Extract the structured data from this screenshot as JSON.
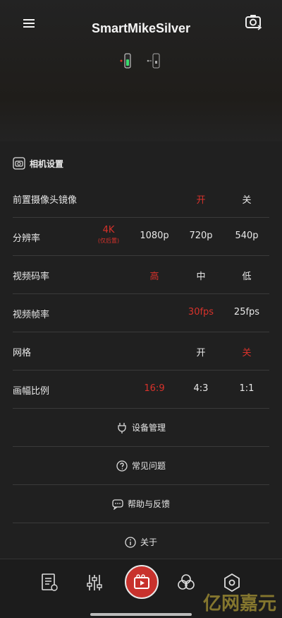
{
  "header": {
    "title": "SmartMikeSilver",
    "icons": [
      "menu-icon",
      "camera-switch-icon",
      "mic-device-icon",
      "phone-device-icon"
    ]
  },
  "section": {
    "label": "相机设置",
    "icon": "camera-settings-icon"
  },
  "settings": {
    "front_mirror": {
      "label": "前置摄像头镜像",
      "on": "开",
      "off": "关",
      "selected": "开"
    },
    "resolution": {
      "label": "分辨率",
      "opt_4k": "4K",
      "opt_4k_note": "(仅后置)",
      "opt_1080": "1080p",
      "opt_720": "720p",
      "opt_540": "540p",
      "selected": "4K"
    },
    "bitrate": {
      "label": "视频码率",
      "high": "高",
      "mid": "中",
      "low": "低",
      "selected": "高"
    },
    "framerate": {
      "label": "视频帧率",
      "fps30": "30fps",
      "fps25": "25fps",
      "selected": "30fps"
    },
    "grid": {
      "label": "网格",
      "on": "开",
      "off": "关",
      "selected": "关"
    },
    "aspect": {
      "label": "画幅比例",
      "r169": "16:9",
      "r43": "4:3",
      "r11": "1:1",
      "selected": "16:9"
    }
  },
  "links": {
    "device_mgmt": "设备管理",
    "faq": "常见问题",
    "help": "帮助与反馈",
    "about": "关于"
  },
  "bottom_nav": [
    "scripts-icon",
    "mixer-icon",
    "record-icon",
    "filters-icon",
    "settings-icon"
  ],
  "watermark": "亿网嘉元",
  "colors": {
    "accent": "#d8322b",
    "background": "#202020",
    "text": "#e8e8e8"
  }
}
